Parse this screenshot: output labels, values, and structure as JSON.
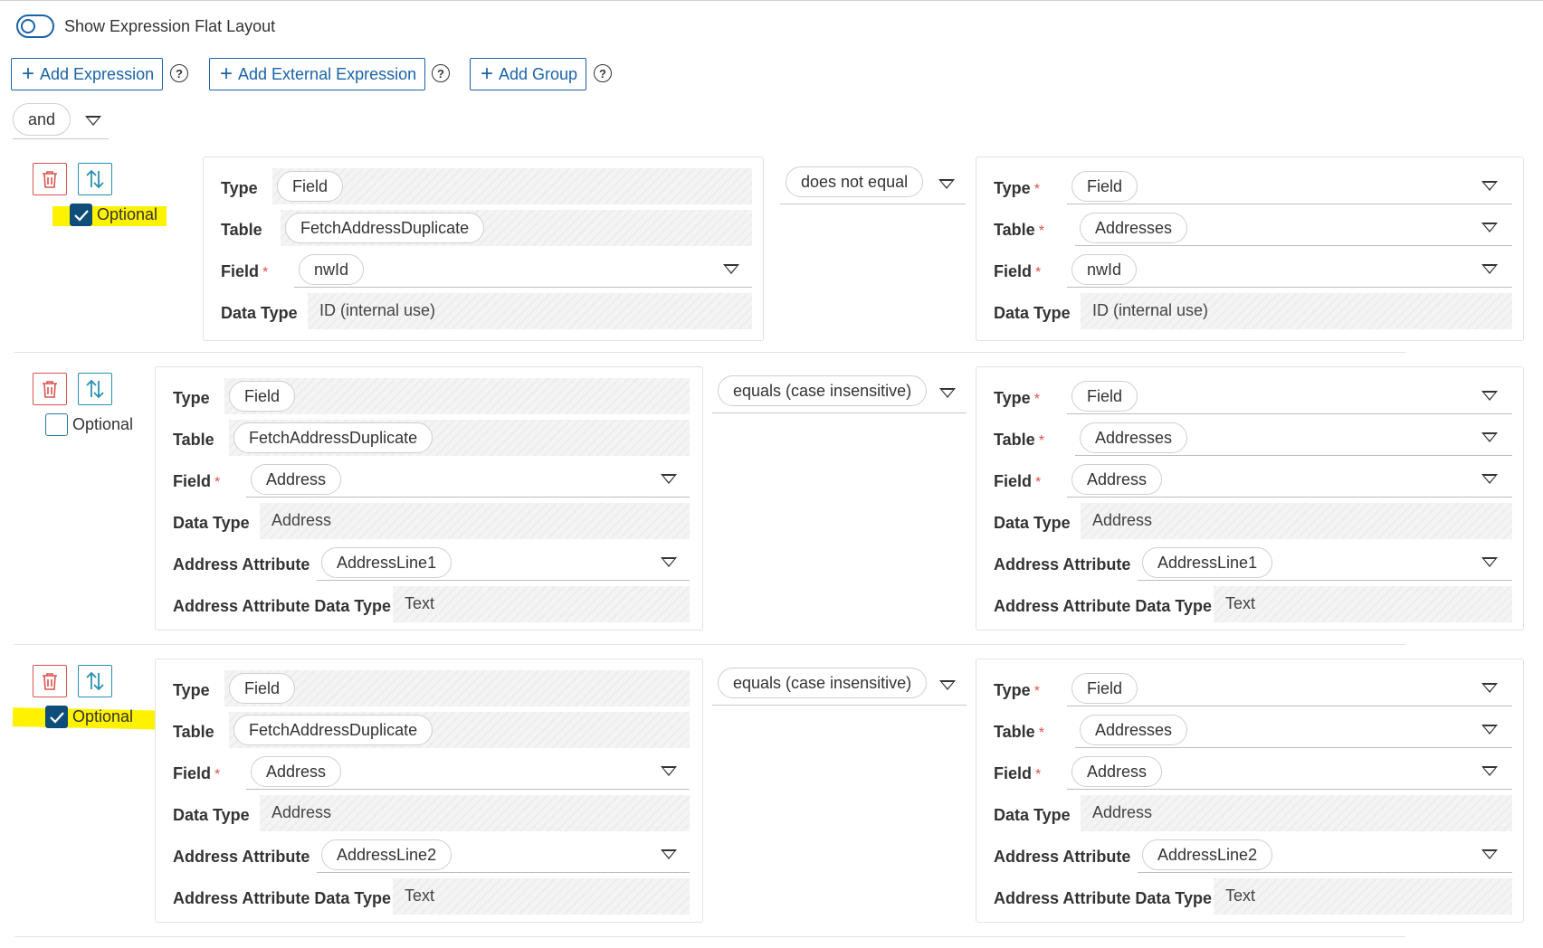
{
  "flat_layout": {
    "label": "Show Expression Flat Layout",
    "enabled": false
  },
  "toolbar": {
    "add_expression": "Add Expression",
    "add_external_expression": "Add External Expression",
    "add_group": "Add Group",
    "help": "?"
  },
  "logic_operator": "and",
  "labels": {
    "type": "Type",
    "table": "Table",
    "field": "Field",
    "data_type": "Data Type",
    "address_attribute": "Address Attribute",
    "address_attribute_data_type": "Address Attribute Data Type",
    "optional": "Optional",
    "required_marker": "*"
  },
  "colors": {
    "accent": "#1a63a6",
    "delete": "#d9534f",
    "swap": "#2a8fb0",
    "checkbox_on": "#0e4d7a",
    "highlight": "#fff200",
    "required": "#d9534f"
  },
  "rows": [
    {
      "optional": true,
      "left": {
        "type": "Field",
        "table": "FetchAddressDuplicate",
        "field": "nwId",
        "data_type": "ID (internal use)"
      },
      "operator": "does not equal",
      "right": {
        "type": "Field",
        "table": "Addresses",
        "field": "nwId",
        "data_type": "ID (internal use)"
      }
    },
    {
      "optional": false,
      "left": {
        "type": "Field",
        "table": "FetchAddressDuplicate",
        "field": "Address",
        "data_type": "Address",
        "address_attribute": "AddressLine1",
        "address_attribute_data_type": "Text"
      },
      "operator": "equals (case insensitive)",
      "right": {
        "type": "Field",
        "table": "Addresses",
        "field": "Address",
        "data_type": "Address",
        "address_attribute": "AddressLine1",
        "address_attribute_data_type": "Text"
      }
    },
    {
      "optional": true,
      "left": {
        "type": "Field",
        "table": "FetchAddressDuplicate",
        "field": "Address",
        "data_type": "Address",
        "address_attribute": "AddressLine2",
        "address_attribute_data_type": "Text"
      },
      "operator": "equals (case insensitive)",
      "right": {
        "type": "Field",
        "table": "Addresses",
        "field": "Address",
        "data_type": "Address",
        "address_attribute": "AddressLine2",
        "address_attribute_data_type": "Text"
      }
    }
  ]
}
